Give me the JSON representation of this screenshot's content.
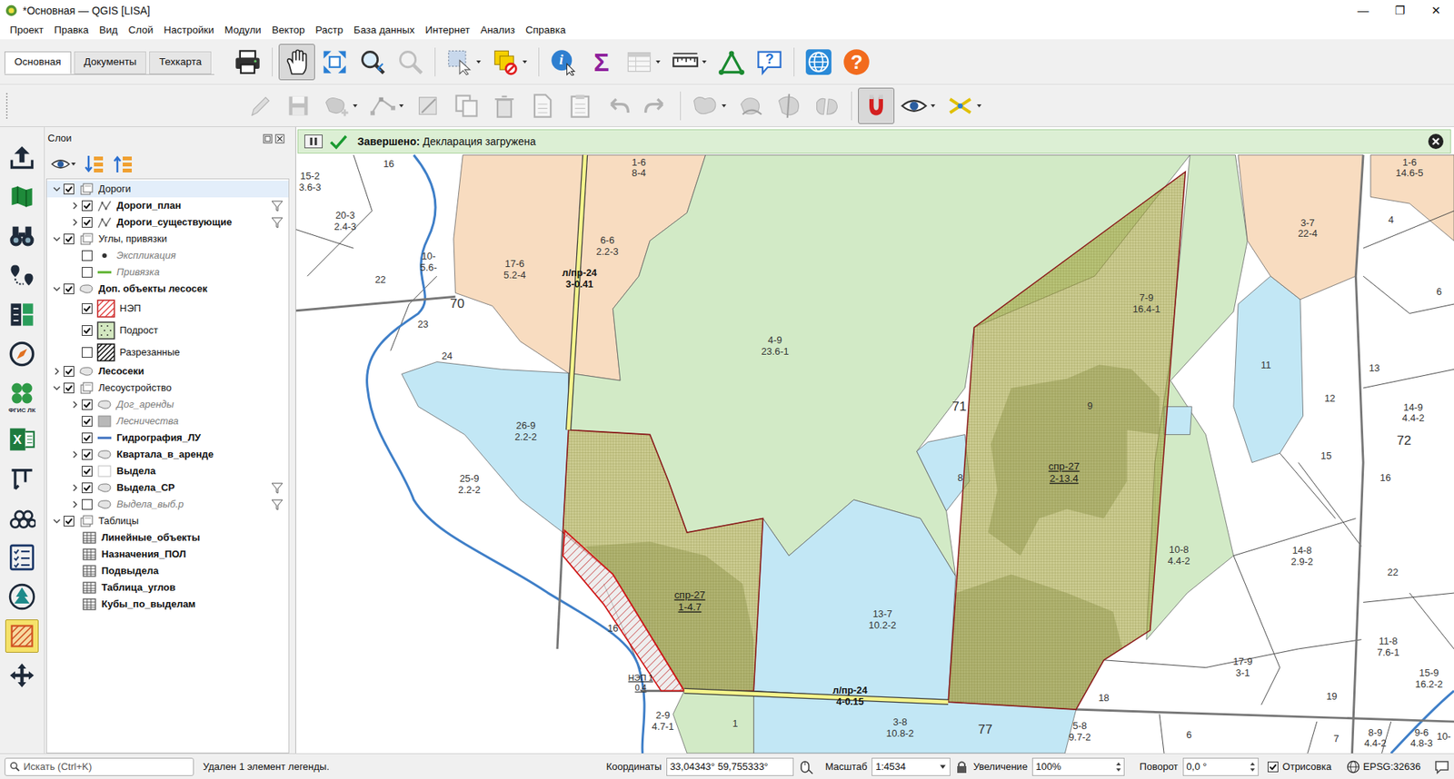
{
  "window": {
    "title": "*Основная — QGIS [LISA]",
    "controls": [
      "—",
      "❐",
      "✕"
    ]
  },
  "menu": [
    "Проект",
    "Правка",
    "Вид",
    "Слой",
    "Настройки",
    "Модули",
    "Вектор",
    "Растр",
    "База данных",
    "Интернет",
    "Анализ",
    "Справка"
  ],
  "toolbar_tabs": [
    {
      "label": "Основная",
      "selected": true
    },
    {
      "label": "Документы",
      "selected": false
    },
    {
      "label": "Техкарта",
      "selected": false
    }
  ],
  "toolbar_main": [
    {
      "kind": "printer",
      "selected": false,
      "disabled": false,
      "dropdown": false
    },
    {
      "kind": "separator"
    },
    {
      "kind": "pan",
      "selected": true,
      "disabled": false,
      "dropdown": false
    },
    {
      "kind": "zoom-full",
      "selected": false,
      "disabled": false,
      "dropdown": false
    },
    {
      "kind": "zoom-in",
      "selected": false,
      "disabled": false,
      "dropdown": false
    },
    {
      "kind": "zoom-last",
      "selected": false,
      "disabled": true,
      "dropdown": false
    },
    {
      "kind": "separator"
    },
    {
      "kind": "select",
      "selected": false,
      "disabled": false,
      "dropdown": true
    },
    {
      "kind": "deselect",
      "selected": false,
      "disabled": false,
      "dropdown": true
    },
    {
      "kind": "separator"
    },
    {
      "kind": "identify",
      "glyph": "i",
      "selected": false,
      "disabled": false,
      "dropdown": false
    },
    {
      "kind": "stats",
      "glyph": "Σ",
      "selected": false,
      "disabled": false,
      "dropdown": false
    },
    {
      "kind": "attr-table",
      "selected": false,
      "disabled": true,
      "dropdown": true
    },
    {
      "kind": "measure",
      "selected": false,
      "disabled": false,
      "dropdown": true
    },
    {
      "kind": "georef",
      "selected": false,
      "disabled": false,
      "dropdown": false
    },
    {
      "kind": "help-bubble",
      "glyph": "?",
      "selected": false,
      "disabled": false,
      "dropdown": false
    },
    {
      "kind": "separator"
    },
    {
      "kind": "globe",
      "selected": false,
      "disabled": false,
      "dropdown": false
    },
    {
      "kind": "help",
      "glyph": "?",
      "selected": false,
      "disabled": false,
      "dropdown": false
    }
  ],
  "toolbar_edit": [
    {
      "kind": "edit",
      "selected": false,
      "disabled": true,
      "dropdown": false
    },
    {
      "kind": "save",
      "selected": false,
      "disabled": true,
      "dropdown": false
    },
    {
      "kind": "add-feature",
      "selected": false,
      "disabled": true,
      "dropdown": true
    },
    {
      "kind": "vertex",
      "selected": false,
      "disabled": true,
      "dropdown": true
    },
    {
      "kind": "digitize",
      "selected": false,
      "disabled": true,
      "dropdown": false
    },
    {
      "kind": "copy",
      "selected": false,
      "disabled": true,
      "dropdown": false
    },
    {
      "kind": "delete",
      "selected": false,
      "disabled": true,
      "dropdown": false
    },
    {
      "kind": "cut-paste",
      "selected": false,
      "disabled": true,
      "dropdown": false
    },
    {
      "kind": "paste",
      "selected": false,
      "disabled": true,
      "dropdown": false
    },
    {
      "kind": "undo",
      "selected": false,
      "disabled": true,
      "dropdown": false
    },
    {
      "kind": "redo",
      "selected": false,
      "disabled": true,
      "dropdown": false
    },
    {
      "kind": "separator"
    },
    {
      "kind": "merge",
      "selected": false,
      "disabled": true,
      "dropdown": true
    },
    {
      "kind": "reshape",
      "selected": false,
      "disabled": true,
      "dropdown": false
    },
    {
      "kind": "split",
      "selected": false,
      "disabled": true,
      "dropdown": false
    },
    {
      "kind": "split-parts",
      "selected": false,
      "disabled": true,
      "dropdown": false
    },
    {
      "kind": "separator"
    },
    {
      "kind": "snap",
      "selected": true,
      "disabled": false,
      "dropdown": false
    },
    {
      "kind": "eye",
      "selected": false,
      "disabled": false,
      "dropdown": true
    },
    {
      "kind": "trace",
      "selected": false,
      "disabled": false,
      "dropdown": true
    }
  ],
  "left_toolbar": [
    {
      "kind": "upload",
      "selected": false
    },
    {
      "kind": "map-book",
      "selected": false
    },
    {
      "kind": "binoculars",
      "selected": false
    },
    {
      "kind": "route",
      "selected": false
    },
    {
      "kind": "calc",
      "selected": false
    },
    {
      "kind": "compass",
      "selected": false
    },
    {
      "kind": "fgis",
      "caption": "ФГИС ЛК",
      "selected": false
    },
    {
      "kind": "excel",
      "glyph": "X",
      "selected": false
    },
    {
      "kind": "caliper",
      "selected": false
    },
    {
      "kind": "logs",
      "selected": false
    },
    {
      "kind": "checklist",
      "selected": false
    },
    {
      "kind": "forest",
      "selected": false
    },
    {
      "kind": "hatch",
      "selected": true
    },
    {
      "kind": "move",
      "selected": false
    }
  ],
  "layers_panel": {
    "title": "Слои",
    "tree": [
      {
        "label": "Дороги",
        "kind": "group",
        "expandable": true,
        "expanded": true,
        "checked": true,
        "selected": true,
        "bold": false,
        "dimmed": false,
        "filter": false,
        "children": [
          {
            "label": "Дороги_план",
            "kind": "line",
            "expandable": true,
            "expanded": false,
            "checked": true,
            "selected": false,
            "bold": true,
            "dimmed": false,
            "filter": true
          },
          {
            "label": "Дороги_существующие",
            "kind": "line",
            "expandable": true,
            "expanded": false,
            "checked": true,
            "selected": false,
            "bold": true,
            "dimmed": false,
            "filter": true
          }
        ]
      },
      {
        "label": "Углы, привязки",
        "kind": "group",
        "expandable": true,
        "expanded": true,
        "checked": true,
        "selected": false,
        "bold": false,
        "dimmed": false,
        "filter": false,
        "children": [
          {
            "label": "Экспликация",
            "kind": "point",
            "expandable": false,
            "expanded": false,
            "checked": false,
            "selected": false,
            "bold": false,
            "dimmed": true,
            "filter": false
          },
          {
            "label": "Привязка",
            "kind": "green-line",
            "expandable": false,
            "expanded": false,
            "checked": false,
            "selected": false,
            "bold": false,
            "dimmed": true,
            "filter": false
          }
        ]
      },
      {
        "label": "Доп. объекты лесосек",
        "kind": "polygon",
        "expandable": true,
        "expanded": true,
        "checked": true,
        "selected": false,
        "bold": true,
        "dimmed": false,
        "filter": false,
        "children": [
          {
            "label": "НЭП",
            "kind": "legend-red-hatch",
            "expandable": false,
            "expanded": false,
            "checked": true,
            "selected": false,
            "bold": false,
            "dimmed": false,
            "filter": false
          },
          {
            "label": "Подрост",
            "kind": "legend-dots",
            "expandable": false,
            "expanded": false,
            "checked": true,
            "selected": false,
            "bold": false,
            "dimmed": false,
            "filter": false
          },
          {
            "label": "Разрезанные",
            "kind": "legend-black-hatch",
            "expandable": false,
            "expanded": false,
            "checked": false,
            "selected": false,
            "bold": false,
            "dimmed": false,
            "filter": false
          }
        ]
      },
      {
        "label": "Лесосеки",
        "kind": "polygon",
        "expandable": true,
        "expanded": false,
        "checked": true,
        "selected": false,
        "bold": true,
        "dimmed": false,
        "filter": false
      },
      {
        "label": "Лесоустройство",
        "kind": "group",
        "expandable": true,
        "expanded": true,
        "checked": true,
        "selected": false,
        "bold": false,
        "dimmed": false,
        "filter": false,
        "children": [
          {
            "label": "Дог_аренды",
            "kind": "polygon",
            "expandable": true,
            "expanded": false,
            "checked": true,
            "selected": false,
            "bold": false,
            "dimmed": true,
            "filter": false
          },
          {
            "label": "Лесничества",
            "kind": "grey-fill",
            "expandable": false,
            "expanded": false,
            "checked": true,
            "selected": false,
            "bold": false,
            "dimmed": true,
            "filter": false
          },
          {
            "label": "Гидрография_ЛУ",
            "kind": "blue-line",
            "expandable": false,
            "expanded": false,
            "checked": true,
            "selected": false,
            "bold": true,
            "dimmed": false,
            "filter": false
          },
          {
            "label": "Квартала_в_аренде",
            "kind": "polygon",
            "expandable": true,
            "expanded": false,
            "checked": true,
            "selected": false,
            "bold": true,
            "dimmed": false,
            "filter": false
          },
          {
            "label": "Выдела",
            "kind": "white-fill",
            "expandable": false,
            "expanded": false,
            "checked": true,
            "selected": false,
            "bold": true,
            "dimmed": false,
            "filter": false
          },
          {
            "label": "Выдела_СР",
            "kind": "polygon",
            "expandable": true,
            "expanded": false,
            "checked": true,
            "selected": false,
            "bold": true,
            "dimmed": false,
            "filter": true
          },
          {
            "label": "Выдела_выб.р",
            "kind": "polygon",
            "expandable": true,
            "expanded": false,
            "checked": false,
            "selected": false,
            "bold": false,
            "dimmed": true,
            "filter": true
          }
        ]
      },
      {
        "label": "Таблицы",
        "kind": "group",
        "expandable": true,
        "expanded": true,
        "checked": true,
        "selected": false,
        "bold": false,
        "dimmed": false,
        "filter": false,
        "children": [
          {
            "label": "Линейные_объекты",
            "kind": "table",
            "expandable": false,
            "expanded": false,
            "selected": false,
            "bold": true,
            "dimmed": false,
            "filter": false
          },
          {
            "label": "Назначения_ПОЛ",
            "kind": "table",
            "expandable": false,
            "expanded": false,
            "selected": false,
            "bold": true,
            "dimmed": false,
            "filter": false
          },
          {
            "label": "Подвыдела",
            "kind": "table",
            "expandable": false,
            "expanded": false,
            "selected": false,
            "bold": true,
            "dimmed": false,
            "filter": false
          },
          {
            "label": "Таблица_углов",
            "kind": "table",
            "expandable": false,
            "expanded": false,
            "selected": false,
            "bold": true,
            "dimmed": false,
            "filter": false
          },
          {
            "label": "Кубы_по_выделам",
            "kind": "table",
            "expandable": false,
            "expanded": false,
            "selected": false,
            "bold": true,
            "dimmed": false,
            "filter": false
          }
        ]
      }
    ]
  },
  "message_bar": {
    "status": "Завершено:",
    "text": "Декларация загружена"
  },
  "map": {
    "labels": [
      {
        "lines": [
          "16"
        ],
        "kind": "plain"
      },
      {
        "lines": [
          "15-2",
          "3.6-3"
        ],
        "kind": "plain"
      },
      {
        "lines": [
          "20-3",
          "2.4-3"
        ],
        "kind": "plain"
      },
      {
        "lines": [
          "1-6",
          "8-4"
        ],
        "kind": "plain"
      },
      {
        "lines": [
          "6-6",
          "2.2-3"
        ],
        "kind": "plain"
      },
      {
        "lines": [
          "17-6",
          "5.2-4"
        ],
        "kind": "plain"
      },
      {
        "lines": [
          "10-",
          "5.6-"
        ],
        "kind": "plain"
      },
      {
        "lines": [
          "22"
        ],
        "kind": "plain"
      },
      {
        "lines": [
          "70"
        ],
        "kind": "quarter"
      },
      {
        "lines": [
          "23"
        ],
        "kind": "plain"
      },
      {
        "lines": [
          "24"
        ],
        "kind": "plain"
      },
      {
        "lines": [
          "л/пр-24",
          "3-0.41"
        ],
        "kind": "road"
      },
      {
        "lines": [
          "4-9",
          "23.6-1"
        ],
        "kind": "plain"
      },
      {
        "lines": [
          "26-9",
          "2.2-2"
        ],
        "kind": "plain"
      },
      {
        "lines": [
          "25-9",
          "2.2-2"
        ],
        "kind": "plain"
      },
      {
        "lines": [
          "7-9",
          "16.4-1"
        ],
        "kind": "plain"
      },
      {
        "lines": [
          "71"
        ],
        "kind": "quarter"
      },
      {
        "lines": [
          "9"
        ],
        "kind": "plain"
      },
      {
        "lines": [
          "8"
        ],
        "kind": "plain"
      },
      {
        "lines": [
          "спр-27",
          "2-13.4"
        ],
        "kind": "cut"
      },
      {
        "lines": [
          "спр-27",
          "1-4.7"
        ],
        "kind": "cut"
      },
      {
        "lines": [
          "16"
        ],
        "kind": "plain"
      },
      {
        "lines": [
          "НЭП 1",
          "0.4"
        ],
        "kind": "cut-small"
      },
      {
        "lines": [
          "13-7",
          "10.2-2"
        ],
        "kind": "plain"
      },
      {
        "lines": [
          "10-8",
          "4.4-2"
        ],
        "kind": "plain"
      },
      {
        "lines": [
          "л/пр-24",
          "4-0.15"
        ],
        "kind": "road"
      },
      {
        "lines": [
          "1"
        ],
        "kind": "plain"
      },
      {
        "lines": [
          "2-9",
          "4.7-1"
        ],
        "kind": "plain"
      },
      {
        "lines": [
          "3-8",
          "10.8-2"
        ],
        "kind": "plain"
      },
      {
        "lines": [
          "77"
        ],
        "kind": "quarter"
      },
      {
        "lines": [
          "18"
        ],
        "kind": "plain"
      },
      {
        "lines": [
          "5-8",
          "9.7-2"
        ],
        "kind": "plain"
      },
      {
        "lines": [
          "17-9",
          "3-1"
        ],
        "kind": "plain"
      },
      {
        "lines": [
          "6"
        ],
        "kind": "plain"
      },
      {
        "lines": [
          "19"
        ],
        "kind": "plain"
      },
      {
        "lines": [
          "7"
        ],
        "kind": "plain"
      },
      {
        "lines": [
          "8-9",
          "4.4-2"
        ],
        "kind": "plain"
      },
      {
        "lines": [
          "9-6",
          "4.8-3"
        ],
        "kind": "plain"
      },
      {
        "lines": [
          "10-"
        ],
        "kind": "plain"
      },
      {
        "lines": [
          "1-6",
          "14.6-5"
        ],
        "kind": "plain"
      },
      {
        "lines": [
          "4"
        ],
        "kind": "plain"
      },
      {
        "lines": [
          "3-7",
          "22-4"
        ],
        "kind": "plain"
      },
      {
        "lines": [
          "6"
        ],
        "kind": "plain"
      },
      {
        "lines": [
          "11"
        ],
        "kind": "plain"
      },
      {
        "lines": [
          "13"
        ],
        "kind": "plain"
      },
      {
        "lines": [
          "12"
        ],
        "kind": "plain"
      },
      {
        "lines": [
          "14-9",
          "4.4-2"
        ],
        "kind": "plain"
      },
      {
        "lines": [
          "72"
        ],
        "kind": "quarter"
      },
      {
        "lines": [
          "15"
        ],
        "kind": "plain"
      },
      {
        "lines": [
          "16"
        ],
        "kind": "plain"
      },
      {
        "lines": [
          "14-8",
          "2.9-2"
        ],
        "kind": "plain"
      },
      {
        "lines": [
          "22"
        ],
        "kind": "plain"
      },
      {
        "lines": [
          "11-8",
          "7.6-1"
        ],
        "kind": "plain"
      },
      {
        "lines": [
          "15-9",
          "16.2-2"
        ],
        "kind": "plain"
      }
    ]
  },
  "status_bar": {
    "search_placeholder": "Искать (Ctrl+K)",
    "message": "Удален 1 элемент легенды.",
    "coordinates_label": "Координаты",
    "coordinates": "33,04343° 59,755333°",
    "scale_label": "Масштаб",
    "scale": "1:4534",
    "magnifier_label": "Увеличение",
    "magnifier": "100%",
    "rotation_label": "Поворот",
    "rotation": "0,0 °",
    "render_label": "Отрисовка",
    "render_checked": true,
    "crs": "EPSG:32636"
  }
}
